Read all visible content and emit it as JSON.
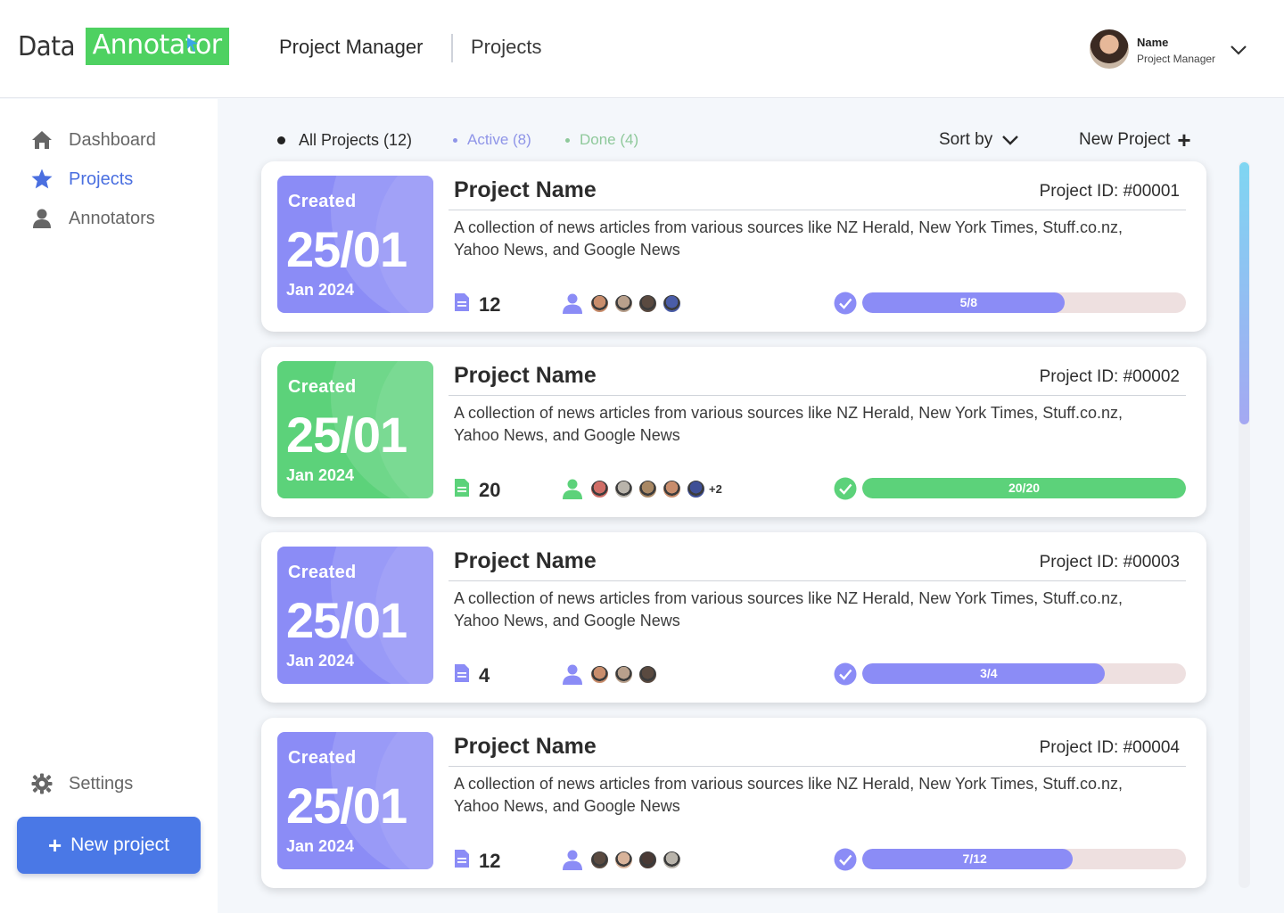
{
  "header": {
    "logo_data": "Data",
    "logo_annotator": "Annotator",
    "breadcrumb_1": "Project Manager",
    "breadcrumb_2": "Projects",
    "user_name": "Name",
    "user_role": "Project Manager"
  },
  "sidebar": {
    "items": [
      {
        "label": "Dashboard",
        "icon": "home-icon"
      },
      {
        "label": "Projects",
        "icon": "star-icon",
        "active": true
      },
      {
        "label": "Annotators",
        "icon": "user-icon"
      }
    ],
    "settings_label": "Settings",
    "new_project_label": "New project"
  },
  "filters": {
    "all": "All Projects (12)",
    "active": "Active (8)",
    "done": "Done (4)",
    "sort_by": "Sort by",
    "new_project": "New Project"
  },
  "colors": {
    "accent_purple": "#8b8cf6",
    "accent_green": "#5cd27a",
    "primary_blue": "#4a78e6"
  },
  "projects": [
    {
      "created_label": "Created",
      "day": "25/01",
      "month": "Jan 2024",
      "title": "Project Name",
      "id": "Project ID: #00001",
      "description": "A collection of news articles from various sources like NZ Herald, New York Times, Stuff.co.nz, Yahoo News, and Google News",
      "documents": "12",
      "avatar_colors": [
        "#c98d6c",
        "#b8a08c",
        "#5a4a40",
        "#4a5da8"
      ],
      "avatar_more": "",
      "progress_label": "5/8",
      "progress": 0.625,
      "theme": "purple"
    },
    {
      "created_label": "Created",
      "day": "25/01",
      "month": "Jan 2024",
      "title": "Project Name",
      "id": "Project ID: #00002",
      "description": "A collection of news articles from various sources like NZ Herald, New York Times, Stuff.co.nz, Yahoo News, and Google News",
      "documents": "20",
      "avatar_colors": [
        "#d06d66",
        "#b9b4ab",
        "#a98864",
        "#c98d6c",
        "#3e4f96"
      ],
      "avatar_more": "+2",
      "progress_label": "20/20",
      "progress": 1.0,
      "theme": "green"
    },
    {
      "created_label": "Created",
      "day": "25/01",
      "month": "Jan 2024",
      "title": "Project Name",
      "id": "Project ID: #00003",
      "description": "A collection of news articles from various sources like NZ Herald, New York Times, Stuff.co.nz, Yahoo News, and Google News",
      "documents": "4",
      "avatar_colors": [
        "#c98d6c",
        "#b8a08c",
        "#5a4a40"
      ],
      "avatar_more": "",
      "progress_label": "3/4",
      "progress": 0.75,
      "theme": "purple"
    },
    {
      "created_label": "Created",
      "day": "25/01",
      "month": "Jan 2024",
      "title": "Project Name",
      "id": "Project ID: #00004",
      "description": "A collection of news articles from various sources like NZ Herald, New York Times, Stuff.co.nz, Yahoo News, and Google News",
      "documents": "12",
      "avatar_colors": [
        "#5a4a40",
        "#d8b39a",
        "#4a3a35",
        "#b9b4ab"
      ],
      "avatar_more": "",
      "progress_label": "7/12",
      "progress": 0.65,
      "theme": "purple"
    }
  ]
}
